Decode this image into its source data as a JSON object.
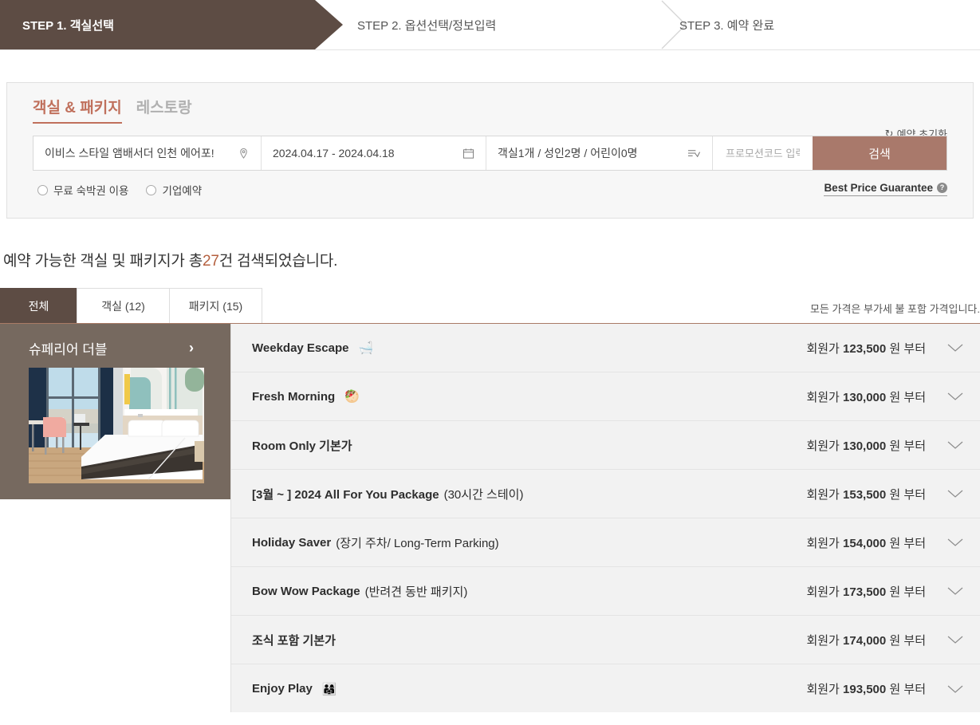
{
  "steps": [
    {
      "label": "STEP 1. 객실선택",
      "active": true
    },
    {
      "label": "STEP 2. 옵션선택/정보입력",
      "active": false
    },
    {
      "label": "STEP 3. 예약 완료",
      "active": false
    }
  ],
  "search": {
    "tabs": [
      {
        "label": "객실 & 패키지",
        "active": true
      },
      {
        "label": "레스토랑",
        "active": false
      }
    ],
    "reset_label": "예약 초기화",
    "reset_icon": "refresh-icon",
    "hotel_value": "이비스 스타일 앰배서더 인천 에어포!",
    "hotel_icon": "location-pin-icon",
    "date_value": "2024.04.17 - 2024.04.18",
    "date_icon": "calendar-icon",
    "guest_value": "객실1개 / 성인2명 / 어린이0명",
    "guest_icon": "list-dropdown-icon",
    "promo_placeholder": "프로모션코드 입력",
    "promo_value": "",
    "search_button": "검색",
    "radios": [
      {
        "label": "무료 숙박권 이용",
        "checked": false
      },
      {
        "label": "기업예약",
        "checked": false
      }
    ],
    "best_price_label": "Best Price Guarantee",
    "best_price_icon": "question-mark-icon"
  },
  "results": {
    "summary_prefix": "예약 가능한 객실 및 패키지가 총",
    "summary_count": "27",
    "summary_suffix": "건 검색되었습니다.",
    "tabs": [
      {
        "label": "전체",
        "active": true
      },
      {
        "label": "객실 (12)",
        "active": false
      },
      {
        "label": "패키지 (15)",
        "active": false
      }
    ],
    "price_note": "모든 가격은 부가세 불 포함 가격입니다."
  },
  "room": {
    "title": "슈페리어 더블",
    "arrow_icon": "chevron-right-icon",
    "photo_name": "superior-double-room-photo"
  },
  "packages": [
    {
      "name": "Weekday Escape",
      "sub": "",
      "emoji": "🛁",
      "price": "123,500",
      "price_prefix": "회원가",
      "price_suffix": "원 부터"
    },
    {
      "name": "Fresh Morning",
      "sub": "",
      "emoji": "🥙",
      "price": "130,000",
      "price_prefix": "회원가",
      "price_suffix": "원 부터"
    },
    {
      "name": "Room Only 기본가",
      "sub": "",
      "emoji": "",
      "price": "130,000",
      "price_prefix": "회원가",
      "price_suffix": "원 부터"
    },
    {
      "name": "[3월 ~ ] 2024 All For You Package",
      "sub": "(30시간 스테이)",
      "emoji": "",
      "price": "153,500",
      "price_prefix": "회원가",
      "price_suffix": "원 부터"
    },
    {
      "name": "Holiday Saver",
      "sub": "(장기 주차/ Long-Term Parking)",
      "emoji": "",
      "price": "154,000",
      "price_prefix": "회원가",
      "price_suffix": "원 부터"
    },
    {
      "name": "Bow Wow Package",
      "sub": "(반려견 동반 패키지)",
      "emoji": "",
      "price": "173,500",
      "price_prefix": "회원가",
      "price_suffix": "원 부터"
    },
    {
      "name": "조식 포함 기본가",
      "sub": "",
      "emoji": "",
      "price": "174,000",
      "price_prefix": "회원가",
      "price_suffix": "원 부터"
    },
    {
      "name": "Enjoy Play",
      "sub": "",
      "emoji": "👨‍👩‍👧",
      "price": "193,500",
      "price_prefix": "회원가",
      "price_suffix": "원 부터"
    }
  ],
  "colors": {
    "step_active": "#5d4c44",
    "accent_orange": "#c0705c",
    "search_button": "#a9796b",
    "room_card_bg": "#76695f",
    "count_color": "#b5603f"
  }
}
